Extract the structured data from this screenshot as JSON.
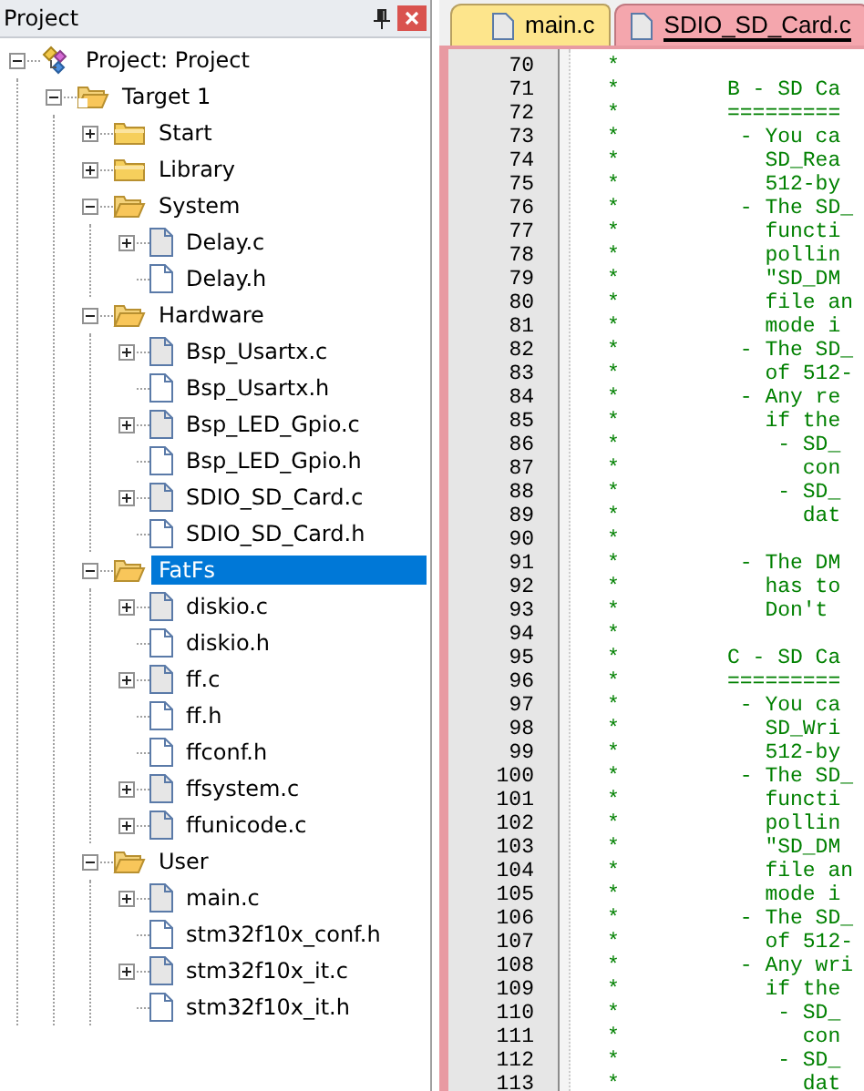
{
  "project_panel": {
    "title": "Project",
    "tree": [
      {
        "label": "Project: Project",
        "kind": "project",
        "expanded": true,
        "selected": false,
        "children": [
          {
            "label": "Target 1",
            "kind": "target",
            "expanded": true,
            "selected": false,
            "children": [
              {
                "label": "Start",
                "kind": "group",
                "expanded": false,
                "selected": false
              },
              {
                "label": "Library",
                "kind": "group",
                "expanded": false,
                "selected": false
              },
              {
                "label": "System",
                "kind": "group",
                "expanded": true,
                "selected": false,
                "children": [
                  {
                    "label": "Delay.c",
                    "kind": "source",
                    "selected": false
                  },
                  {
                    "label": "Delay.h",
                    "kind": "header",
                    "selected": false
                  }
                ]
              },
              {
                "label": "Hardware",
                "kind": "group",
                "expanded": true,
                "selected": false,
                "children": [
                  {
                    "label": "Bsp_Usartx.c",
                    "kind": "source",
                    "selected": false
                  },
                  {
                    "label": "Bsp_Usartx.h",
                    "kind": "header",
                    "selected": false
                  },
                  {
                    "label": "Bsp_LED_Gpio.c",
                    "kind": "source",
                    "selected": false
                  },
                  {
                    "label": "Bsp_LED_Gpio.h",
                    "kind": "header",
                    "selected": false
                  },
                  {
                    "label": "SDIO_SD_Card.c",
                    "kind": "source",
                    "selected": false
                  },
                  {
                    "label": "SDIO_SD_Card.h",
                    "kind": "header",
                    "selected": false
                  }
                ]
              },
              {
                "label": "FatFs",
                "kind": "group",
                "expanded": true,
                "selected": true,
                "children": [
                  {
                    "label": "diskio.c",
                    "kind": "source",
                    "selected": false
                  },
                  {
                    "label": "diskio.h",
                    "kind": "header",
                    "selected": false
                  },
                  {
                    "label": "ff.c",
                    "kind": "source",
                    "selected": false
                  },
                  {
                    "label": "ff.h",
                    "kind": "header",
                    "selected": false
                  },
                  {
                    "label": "ffconf.h",
                    "kind": "header",
                    "selected": false
                  },
                  {
                    "label": "ffsystem.c",
                    "kind": "source",
                    "selected": false
                  },
                  {
                    "label": "ffunicode.c",
                    "kind": "source",
                    "selected": false
                  }
                ]
              },
              {
                "label": "User",
                "kind": "group",
                "expanded": true,
                "selected": false,
                "children": [
                  {
                    "label": "main.c",
                    "kind": "source",
                    "selected": false
                  },
                  {
                    "label": "stm32f10x_conf.h",
                    "kind": "header",
                    "selected": false
                  },
                  {
                    "label": "stm32f10x_it.c",
                    "kind": "source",
                    "selected": false
                  },
                  {
                    "label": "stm32f10x_it.h",
                    "kind": "header",
                    "selected": false
                  }
                ]
              }
            ]
          }
        ]
      }
    ]
  },
  "editor": {
    "tabs": [
      {
        "label": "main.c",
        "selected": false
      },
      {
        "label": "SDIO_SD_Card.c",
        "selected": true
      }
    ],
    "lines": [
      {
        "number": "70",
        "mark": "*"
      },
      {
        "number": "71",
        "mark": "*",
        "text": "B - SD Ca"
      },
      {
        "number": "72",
        "mark": "*",
        "text": "========="
      },
      {
        "number": "73",
        "mark": "*",
        "text": " - You ca"
      },
      {
        "number": "74",
        "mark": "*",
        "text": "   SD_Rea"
      },
      {
        "number": "75",
        "mark": "*",
        "text": "   512-by"
      },
      {
        "number": "76",
        "mark": "*",
        "text": " - The SD_"
      },
      {
        "number": "77",
        "mark": "*",
        "text": "   functi"
      },
      {
        "number": "78",
        "mark": "*",
        "text": "   pollin"
      },
      {
        "number": "79",
        "mark": "*",
        "text": "   \"SD_DM"
      },
      {
        "number": "80",
        "mark": "*",
        "text": "   file an"
      },
      {
        "number": "81",
        "mark": "*",
        "text": "   mode i"
      },
      {
        "number": "82",
        "mark": "*",
        "text": " - The SD_"
      },
      {
        "number": "83",
        "mark": "*",
        "text": "   of 512-"
      },
      {
        "number": "84",
        "mark": "*",
        "text": " - Any re"
      },
      {
        "number": "85",
        "mark": "*",
        "text": "   if the"
      },
      {
        "number": "86",
        "mark": "*",
        "text": "    - SD_"
      },
      {
        "number": "87",
        "mark": "*",
        "text": "      con"
      },
      {
        "number": "88",
        "mark": "*",
        "text": "    - SD_"
      },
      {
        "number": "89",
        "mark": "*",
        "text": "      dat"
      },
      {
        "number": "90",
        "mark": "*"
      },
      {
        "number": "91",
        "mark": "*",
        "text": " - The DM"
      },
      {
        "number": "92",
        "mark": "*",
        "text": "   has to"
      },
      {
        "number": "93",
        "mark": "*",
        "text": "   Don't"
      },
      {
        "number": "94",
        "mark": "*"
      },
      {
        "number": "95",
        "mark": "*",
        "text": "C - SD Ca"
      },
      {
        "number": "96",
        "mark": "*",
        "text": "========="
      },
      {
        "number": "97",
        "mark": "*",
        "text": " - You ca"
      },
      {
        "number": "98",
        "mark": "*",
        "text": "   SD_Wri"
      },
      {
        "number": "99",
        "mark": "*",
        "text": "   512-by"
      },
      {
        "number": "100",
        "mark": "*",
        "text": " - The SD_"
      },
      {
        "number": "101",
        "mark": "*",
        "text": "   functi"
      },
      {
        "number": "102",
        "mark": "*",
        "text": "   pollin"
      },
      {
        "number": "103",
        "mark": "*",
        "text": "   \"SD_DM"
      },
      {
        "number": "104",
        "mark": "*",
        "text": "   file an"
      },
      {
        "number": "105",
        "mark": "*",
        "text": "   mode i"
      },
      {
        "number": "106",
        "mark": "*",
        "text": " - The SD_"
      },
      {
        "number": "107",
        "mark": "*",
        "text": "   of 512-"
      },
      {
        "number": "108",
        "mark": "*",
        "text": " - Any wri"
      },
      {
        "number": "109",
        "mark": "*",
        "text": "   if the"
      },
      {
        "number": "110",
        "mark": "*",
        "text": "    - SD_"
      },
      {
        "number": "111",
        "mark": "*",
        "text": "      con"
      },
      {
        "number": "112",
        "mark": "*",
        "text": "    - SD_"
      },
      {
        "number": "113",
        "mark": "*",
        "text": "      dat"
      }
    ]
  }
}
